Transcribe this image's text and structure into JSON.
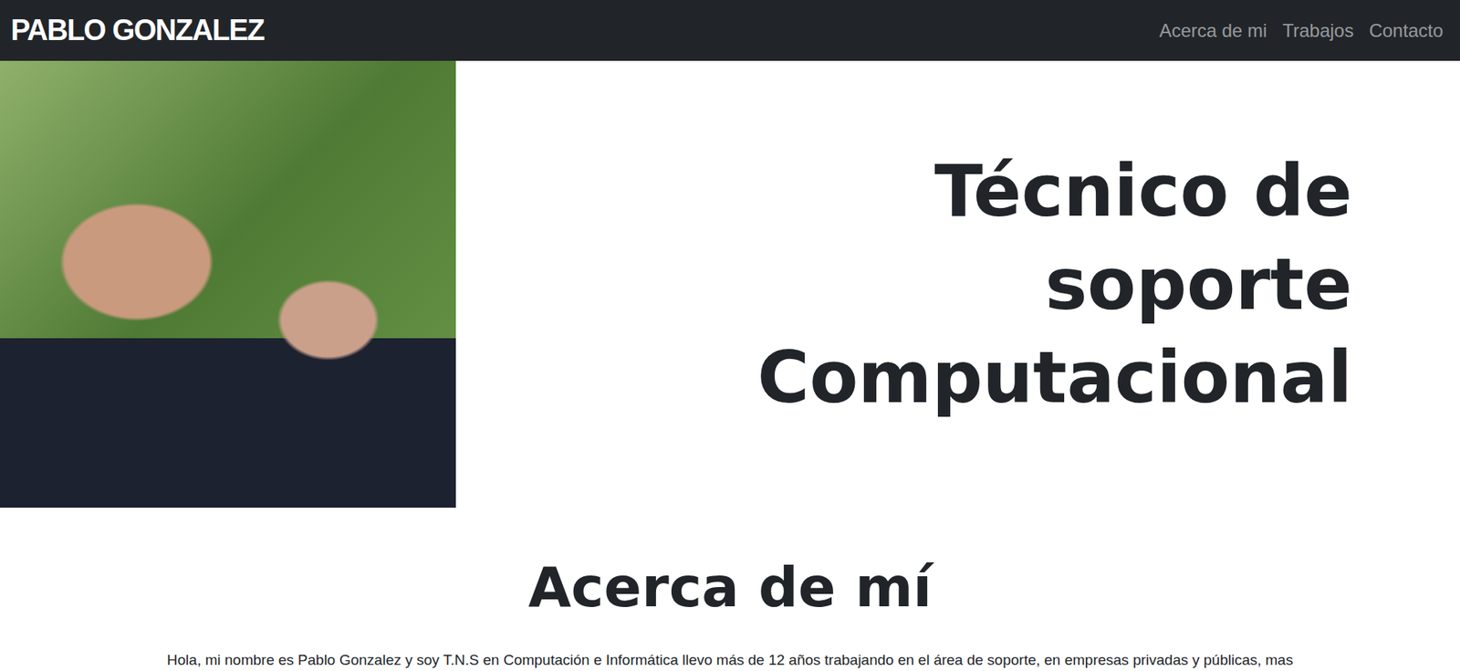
{
  "navbar": {
    "brand": "PABLO GONZALEZ",
    "links": [
      "Acerca de mi",
      "Trabajos",
      "Contacto"
    ]
  },
  "hero": {
    "title": "Técnico de soporte Computacional"
  },
  "about": {
    "title": "Acerca de mí",
    "text": "Hola, mi nombre es Pablo Gonzalez y soy T.N.S en Computación e Informática llevo más de 12 años trabajando en el área de soporte, en empresas privadas y públicas, mas"
  }
}
